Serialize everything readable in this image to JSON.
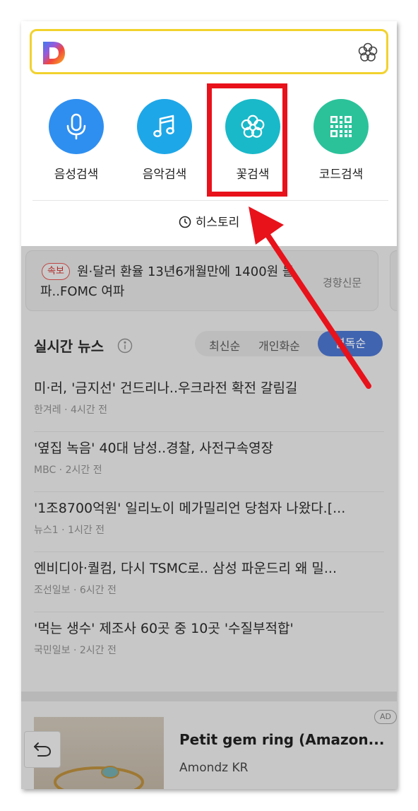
{
  "search": {
    "logo_letter": "D",
    "flower_icon": "flower-icon"
  },
  "tools": [
    {
      "label": "음성검색",
      "icon": "microphone-icon",
      "color": "#2f8ff0"
    },
    {
      "label": "음악검색",
      "icon": "music-note-icon",
      "color": "#1ea7e8"
    },
    {
      "label": "꽃검색",
      "icon": "flower-icon",
      "color": "#19b9c9"
    },
    {
      "label": "코드검색",
      "icon": "qr-code-icon",
      "color": "#2bc29a"
    }
  ],
  "history_label": "히스토리",
  "breaking": {
    "badge": "속보",
    "text": "원·달러 환율 13년6개월만에 1400원 돌파..FOMC 여파",
    "source": "경향신문"
  },
  "realtime": {
    "title": "실시간 뉴스",
    "sort_options": [
      "최신순",
      "개인화순",
      "열독순"
    ],
    "active_sort": "열독순"
  },
  "news": [
    {
      "title": "미·러, '금지선' 건드리나..우크라전 확전 갈림길",
      "source": "한겨레",
      "time": "4시간 전"
    },
    {
      "title": "'옆집 녹음' 40대 남성..경찰, 사전구속영장",
      "source": "MBC",
      "time": "2시간 전"
    },
    {
      "title": "'1조8700억원' 일리노이 메가밀리언 당첨자 나왔다.[...",
      "source": "뉴스1",
      "time": "1시간 전"
    },
    {
      "title": "엔비디아·퀄컴, 다시 TSMC로.. 삼성 파운드리 왜 밀...",
      "source": "조선일보",
      "time": "6시간 전"
    },
    {
      "title": "'먹는 생수' 제조사 60곳 중 10곳 '수질부적합'",
      "source": "국민일보",
      "time": "2시간 전"
    }
  ],
  "ad": {
    "badge": "AD",
    "title": "Petit gem ring (Amazon...",
    "advertiser": "Amondz KR"
  },
  "colors": {
    "highlight": "#e8121b",
    "search_border": "#f2d22e",
    "sort_active": "#4a72c9"
  }
}
